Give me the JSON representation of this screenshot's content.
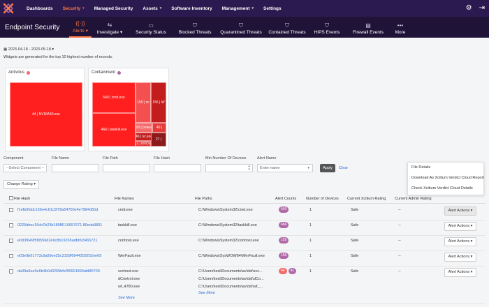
{
  "nav": {
    "items": [
      {
        "label": "Dashboards",
        "chevron": false,
        "active": false
      },
      {
        "label": "Security",
        "chevron": true,
        "active": true
      },
      {
        "label": "Managed Security",
        "chevron": false,
        "active": false
      },
      {
        "label": "Assets",
        "chevron": true,
        "active": false
      },
      {
        "label": "Software Inventory",
        "chevron": false,
        "active": false
      },
      {
        "label": "Management",
        "chevron": true,
        "active": false
      },
      {
        "label": "Settings",
        "chevron": false,
        "active": false
      }
    ],
    "accent": "#ff7a45"
  },
  "subnav": {
    "title": "Endpoint Security",
    "tabs": [
      {
        "label": "Alerts ▾",
        "icon": "signal-icon",
        "glyph": "((·))",
        "active": true
      },
      {
        "label": "Investigate ▾",
        "icon": "investigate-icon",
        "glyph": "⇆",
        "active": false
      },
      {
        "label": "Security Status",
        "icon": "status-icon",
        "glyph": "▭",
        "active": false
      },
      {
        "label": "Blocked Threats",
        "icon": "blocked-icon",
        "glyph": "⛉",
        "active": false
      },
      {
        "label": "Quarantined Threats",
        "icon": "quarantine-icon",
        "glyph": "⛉",
        "active": false
      },
      {
        "label": "Contained Threats",
        "icon": "contained-icon",
        "glyph": "⛉",
        "active": false
      },
      {
        "label": "HIPS Events",
        "icon": "hips-icon",
        "glyph": "⛉",
        "active": false
      },
      {
        "label": "Firewall Events",
        "icon": "firewall-icon",
        "glyph": "▤",
        "active": false
      },
      {
        "label": "More",
        "icon": "more-icon",
        "glyph": "•••",
        "active": false
      }
    ]
  },
  "header": {
    "date_range": "2023-04-18 - 2023-05-18",
    "widgets_note": "Widgets are generated for the top 10 highest number of records."
  },
  "antivirus": {
    "title": "Antivirus",
    "dot_color": "#f26c6c",
    "tiles": [
      {
        "label": "44 | NVDIA40.exe",
        "color": "#ff1f1f"
      }
    ]
  },
  "containment": {
    "title": "Containment",
    "dot_color": "#b06aa8",
    "tiles": [
      {
        "label": "540 | cmd.exe",
        "color": "#ff1f1f"
      },
      {
        "label": "466 | taskkill.exe",
        "color": "#ff1f1f"
      },
      {
        "label": "159 | cc",
        "color": "#f45050"
      },
      {
        "label": "156 | W",
        "color": "#c21c1c"
      },
      {
        "label": "69 | power",
        "color": "#f56b6b"
      },
      {
        "label": "40 |",
        "color": "#e73a3a"
      },
      {
        "label": "46 | sc.exe",
        "color": "#c52020"
      },
      {
        "label": "41 | NVDIA",
        "color": "#e63838"
      },
      {
        "label": "27 |",
        "color": "#8d1a1a"
      }
    ]
  },
  "filters": {
    "component_label": "Component",
    "component_value": "--Select Component --",
    "file_name_label": "File Name",
    "file_path_label": "File Path",
    "file_hash_label": "File Hash",
    "min_devices_label": "Min Number Of Devices",
    "alert_name_label": "Alert Name",
    "alert_name_placeholder": "Enter name",
    "apply_label": "Apply",
    "clear_label": "Clear"
  },
  "change_rating_label": "Change Rating ▾",
  "dropdown": {
    "items": [
      "File Details",
      "Download As Xcitium Verdict Cloud Report",
      "Check Xcitium Verdict Cloud Details"
    ]
  },
  "table": {
    "columns": [
      "File Hash",
      "File Names",
      "File Paths",
      "Alert Counts",
      "Number of Devices",
      "Current Xcitium Rating",
      "Current Admin Rating"
    ],
    "rows": [
      {
        "hash": "f1efb0fddc156e4c61c5f78a54700e4e7984d55d",
        "names": [
          "cmd.exe"
        ],
        "paths": [
          "C:\\Windows\\System32\\cmd.exe"
        ],
        "counts": [
          {
            "v": "540",
            "c": "purple"
          }
        ],
        "devices": "1",
        "xrating": "Safe",
        "arating": "--",
        "action": "Alert Actions ▾"
      },
      {
        "hash": "0225bbec16cb7b23b189f8110657671 80eda9801",
        "names": [
          "taskkill.exe"
        ],
        "paths": [
          "C:\\Windows\\System32\\taskkill.exe"
        ],
        "counts": [
          {
            "v": "466",
            "c": "purple"
          }
        ],
        "devices": "1",
        "xrating": "Safe",
        "arating": "--",
        "action": "Alert Actions ▾"
      },
      {
        "hash": "e0d3f649f5f0556d2e6c8b19265adbb93465721",
        "names": [
          "conhost.exe"
        ],
        "paths": [
          "C:\\Windows\\System32\\conhost.exe"
        ],
        "counts": [
          {
            "v": "159",
            "c": "purple"
          }
        ],
        "devices": "1",
        "xrating": "Safe",
        "arating": "--",
        "action": "Alert Actions ▾"
      },
      {
        "hash": "e03e9b61773c9a99ee25c3159f6644209252ee69",
        "names": [
          "WerFault.exe"
        ],
        "paths": [
          "C:\\Windows\\SysWOW64\\WerFault.exe"
        ],
        "counts": [
          {
            "v": "156",
            "c": "purple"
          }
        ],
        "devices": "1",
        "xrating": "Safe",
        "arating": "--",
        "action": "Alert Actions ▾"
      },
      {
        "hash": "da39a3ee5e6b4b0d3255bfef95601890afd80709",
        "names": [
          "svchost.exe",
          "dControl.exe",
          "wf_4780.exe"
        ],
        "paths": [
          "C:\\Users\\test\\Documents\\av\\dst\\svc...",
          "C:\\Users\\test\\Documents\\av\\dst\\dCo...",
          "C:\\Users\\test\\Documents\\av\\dst\\wf_..."
        ],
        "counts": [
          {
            "v": "44",
            "c": "red"
          },
          {
            "v": "41",
            "c": "purple"
          }
        ],
        "devices": "1",
        "xrating": "Safe",
        "arating": "--",
        "action": "Alert Actions ▾"
      }
    ],
    "see_more_label": "See More"
  }
}
